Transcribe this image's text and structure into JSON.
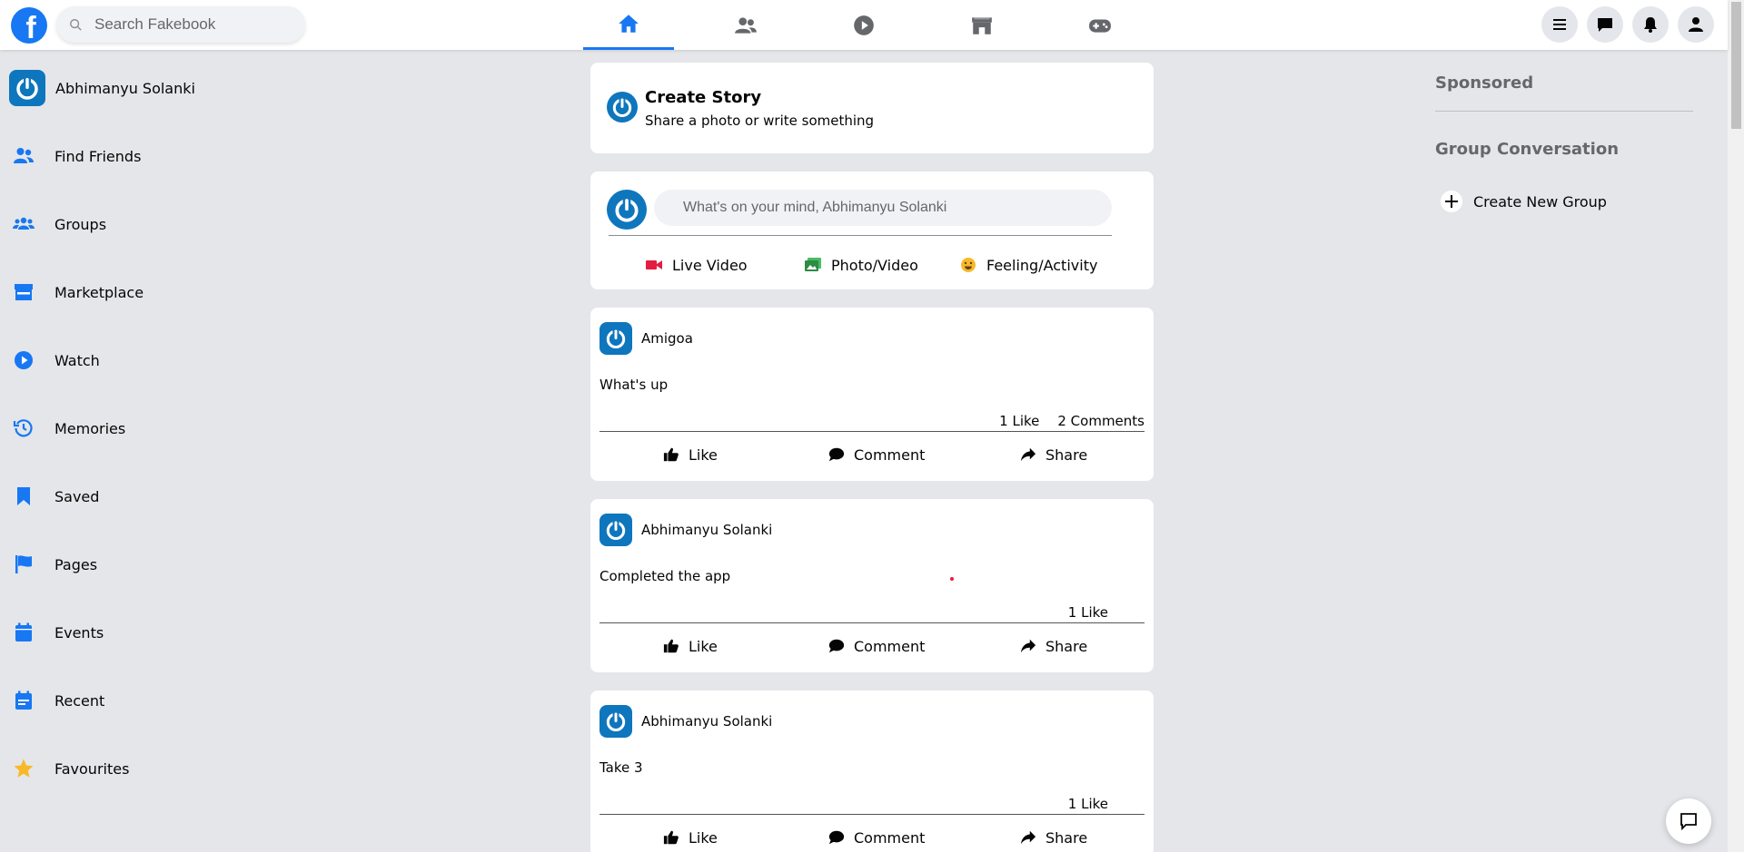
{
  "topbar": {
    "search_placeholder": "Search Fakebook",
    "nav_tabs": [
      {
        "icon": "home-icon",
        "active": true
      },
      {
        "icon": "friends-icon",
        "active": false
      },
      {
        "icon": "watch-icon",
        "active": false
      },
      {
        "icon": "marketplace-icon",
        "active": false
      },
      {
        "icon": "gaming-icon",
        "active": false
      }
    ],
    "right_buttons": [
      "menu-icon",
      "messenger-icon",
      "notifications-icon",
      "account-icon"
    ]
  },
  "sidebar": {
    "user_name": "Abhimanyu Solanki",
    "items": [
      {
        "label": "Find Friends",
        "icon": "friends-icon"
      },
      {
        "label": "Groups",
        "icon": "groups-icon"
      },
      {
        "label": "Marketplace",
        "icon": "marketplace-icon"
      },
      {
        "label": "Watch",
        "icon": "watch-icon"
      },
      {
        "label": "Memories",
        "icon": "memories-icon"
      },
      {
        "label": "Saved",
        "icon": "bookmark-icon"
      },
      {
        "label": "Pages",
        "icon": "flag-icon"
      },
      {
        "label": "Events",
        "icon": "calendar-icon"
      },
      {
        "label": "Recent",
        "icon": "calendar-recent-icon"
      },
      {
        "label": "Favourites",
        "icon": "star-icon"
      }
    ]
  },
  "story": {
    "title": "Create Story",
    "subtitle": "Share a photo or write something"
  },
  "composer": {
    "placeholder": "What's on your mind, Abhimanyu Solanki",
    "actions": [
      "Live Video",
      "Photo/Video",
      "Feeling/Activity"
    ]
  },
  "posts": [
    {
      "author": "Amigoa",
      "text": "What's up",
      "likes": "1 Like",
      "comments": "2 Comments"
    },
    {
      "author": "Abhimanyu Solanki",
      "text": "Completed the app",
      "likes": "1 Like",
      "comments": ""
    },
    {
      "author": "Abhimanyu Solanki",
      "text": "Take 3",
      "likes": "1 Like",
      "comments": ""
    }
  ],
  "post_actions": {
    "like": "Like",
    "comment": "Comment",
    "share": "Share"
  },
  "right_panel": {
    "sponsored": "Sponsored",
    "group_conversation": "Group Conversation",
    "create_group": "Create New Group"
  },
  "colors": {
    "brand": "#1877f2",
    "avatar": "#0e76bd",
    "live": "#e41e3f",
    "photo": "#45bd62",
    "feeling": "#f7b928"
  }
}
